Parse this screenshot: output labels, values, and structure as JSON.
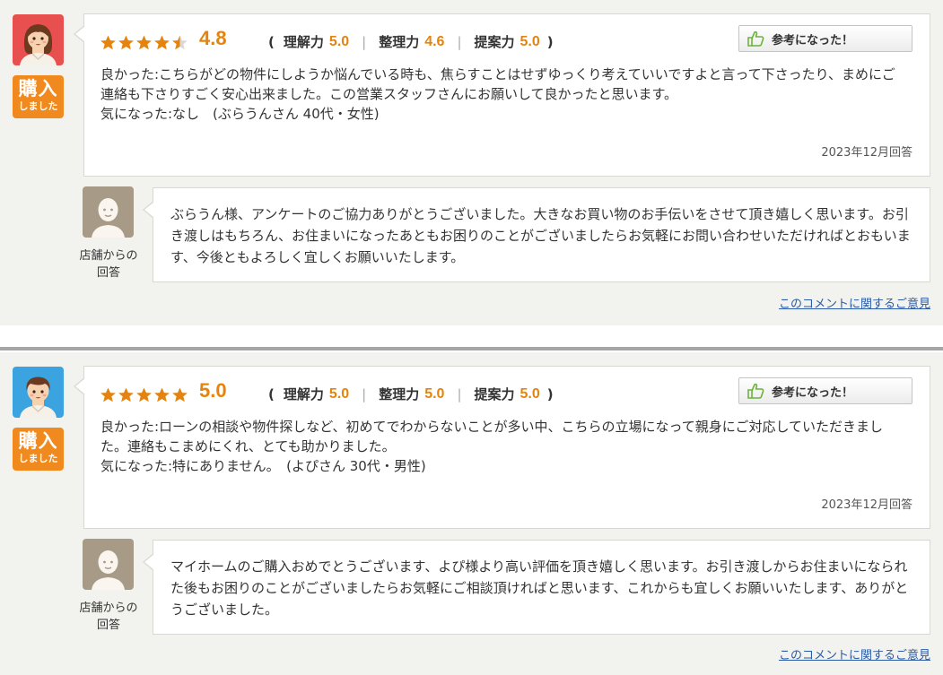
{
  "reviews": [
    {
      "rating": 4.8,
      "score_text": "4.8",
      "star_fills": [
        1,
        1,
        1,
        1,
        0.5
      ],
      "avatar": "female-avatar-icon",
      "avatar_bg": "#e8504f",
      "badge": {
        "main": "購入",
        "sub": "しました"
      },
      "subscores": {
        "open": "(",
        "close": ")",
        "understanding_label": "理解力",
        "understanding_value": "5.0",
        "organization_label": "整理力",
        "organization_value": "4.6",
        "proposal_label": "提案力",
        "proposal_value": "5.0"
      },
      "helpful_label": "参考になった！",
      "good_text": "良かった:こちらがどの物件にしようか悩んでいる時も、焦らすことはせずゆっくり考えていいですよと言って下さったり、まめにご連絡も下さりすごく安心出来ました。この営業スタッフさんにお願いして良かったと思います。",
      "concern_text": "気になった:なし　(ぶらうんさん 40代・女性)",
      "date": "2023年12月回答",
      "reply_caption": "店舗からの回答",
      "reply_text": "ぶらうん様、アンケートのご協力ありがとうございました。大きなお買い物のお手伝いをさせて頂き嬉しく思います。お引き渡しはもちろん、お住まいになったあともお困りのことがございましたらお気軽にお問い合わせいただければとおもいます、今後ともよろしく宜しくお願いいたします。",
      "comment_link": "このコメントに関するご意見"
    },
    {
      "rating": 5.0,
      "score_text": "5.0",
      "star_fills": [
        1,
        1,
        1,
        1,
        1
      ],
      "avatar": "male-avatar-icon",
      "avatar_bg": "#3ba3e0",
      "badge": {
        "main": "購入",
        "sub": "しました"
      },
      "subscores": {
        "open": "(",
        "close": ")",
        "understanding_label": "理解力",
        "understanding_value": "5.0",
        "organization_label": "整理力",
        "organization_value": "5.0",
        "proposal_label": "提案力",
        "proposal_value": "5.0"
      },
      "helpful_label": "参考になった！",
      "good_text": "良かった:ローンの相談や物件探しなど、初めてでわからないことが多い中、こちらの立場になって親身にご対応していただきました。連絡もこまめにくれ、とても助かりました。",
      "concern_text": "気になった:特にありません。　(よぴさん 30代・男性)",
      "date": "2023年12月回答",
      "reply_caption": "店舗からの回答",
      "reply_text": "マイホームのご購入おめでとうございます、よぴ様より高い評価を頂き嬉しく思います。お引き渡しからお住まいになられた後もお困りのことがございましたらお気軽にご相談頂ければと思います、これからも宜しくお願いいたします、ありがとうございました。",
      "comment_link": "このコメントに関するご意見"
    }
  ],
  "colors": {
    "accent_orange": "#e4840e",
    "badge_orange": "#f08a1e",
    "link_blue": "#2b5ba6",
    "star_empty": "#d9d9d9"
  }
}
